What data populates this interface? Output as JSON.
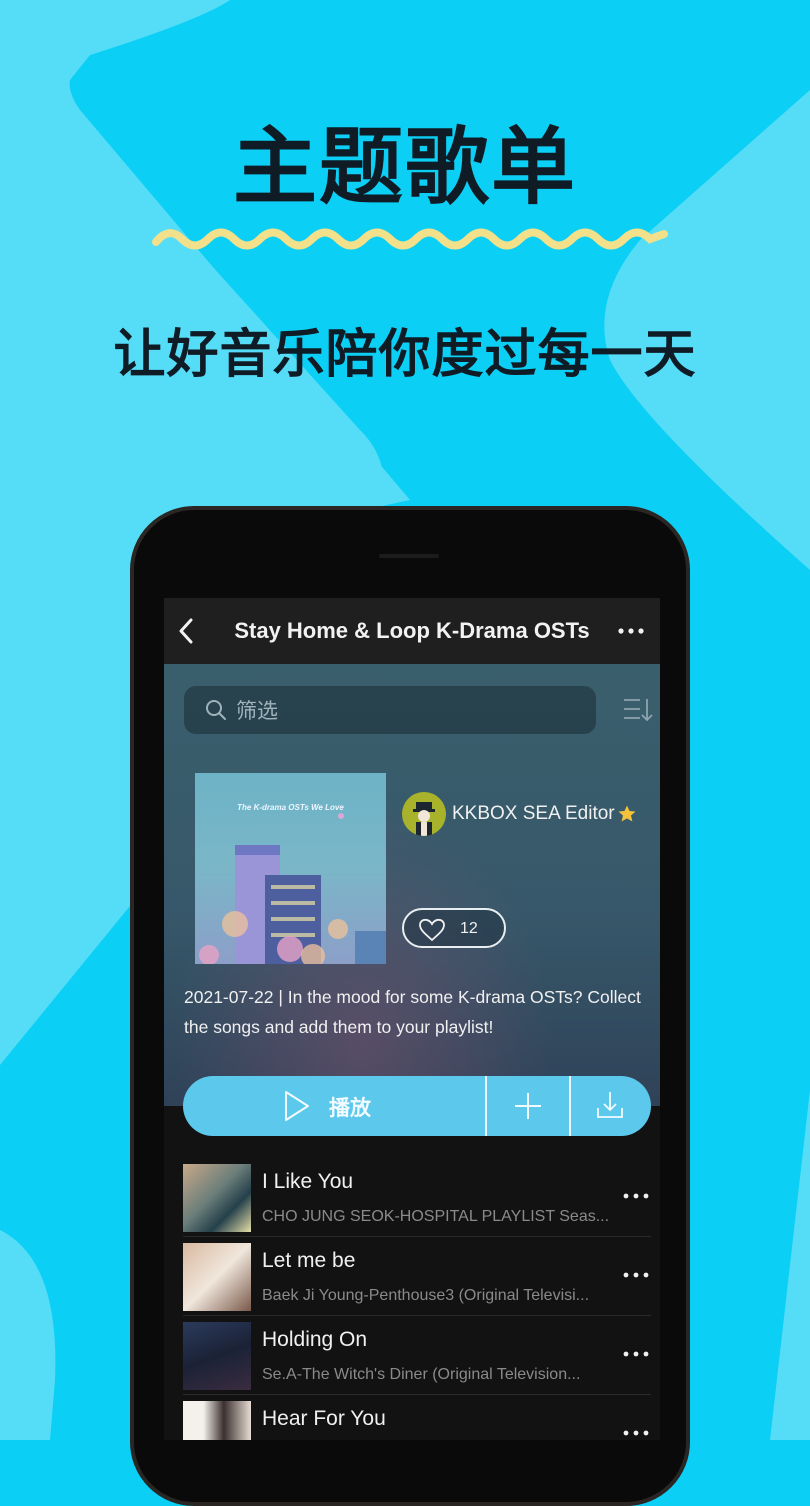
{
  "promo": {
    "title": "主题歌单",
    "subtitle": "让好音乐陪你度过每一天",
    "colors": {
      "background": "#0ccff5",
      "background_light": "#55ddf8",
      "wave": "#f2e08a",
      "text": "#0f1c26"
    }
  },
  "app": {
    "navbar": {
      "back_icon": "chevron-left-icon",
      "title": "Stay Home & Loop K-Drama OSTs",
      "more_icon": "ellipsis-horizontal-icon"
    },
    "search": {
      "placeholder": "筛选",
      "value": "",
      "icon": "search-icon",
      "sort_icon": "sort-descending-icon"
    },
    "playlist": {
      "cover_title": "The K-drama OSTs We Love",
      "editor_name": "KKBOX SEA Editor",
      "editor_badge_icon": "star-icon",
      "like_count": "12",
      "like_icon": "heart-outline-icon",
      "description": "2021-07-22 | In the mood for some K-drama OSTs? Collect the songs and add them to your playlist!"
    },
    "actions": {
      "play_label": "播放",
      "play_icon": "play-outline-icon",
      "add_icon": "plus-icon",
      "download_icon": "download-icon",
      "accent_color": "#5bc8ec"
    },
    "tracks": [
      {
        "title": "I Like You",
        "subtitle": "CHO JUNG SEOK-HOSPITAL PLAYLIST Seas...",
        "more_icon": "ellipsis-horizontal-icon"
      },
      {
        "title": "Let me be",
        "subtitle": "Baek Ji Young-Penthouse3 (Original Televisi...",
        "more_icon": "ellipsis-horizontal-icon"
      },
      {
        "title": "Holding On",
        "subtitle": "Se.A-The Witch's Diner (Original Television...",
        "more_icon": "ellipsis-horizontal-icon"
      },
      {
        "title": "Hear For You",
        "subtitle": "",
        "more_icon": "ellipsis-horizontal-icon"
      }
    ]
  }
}
